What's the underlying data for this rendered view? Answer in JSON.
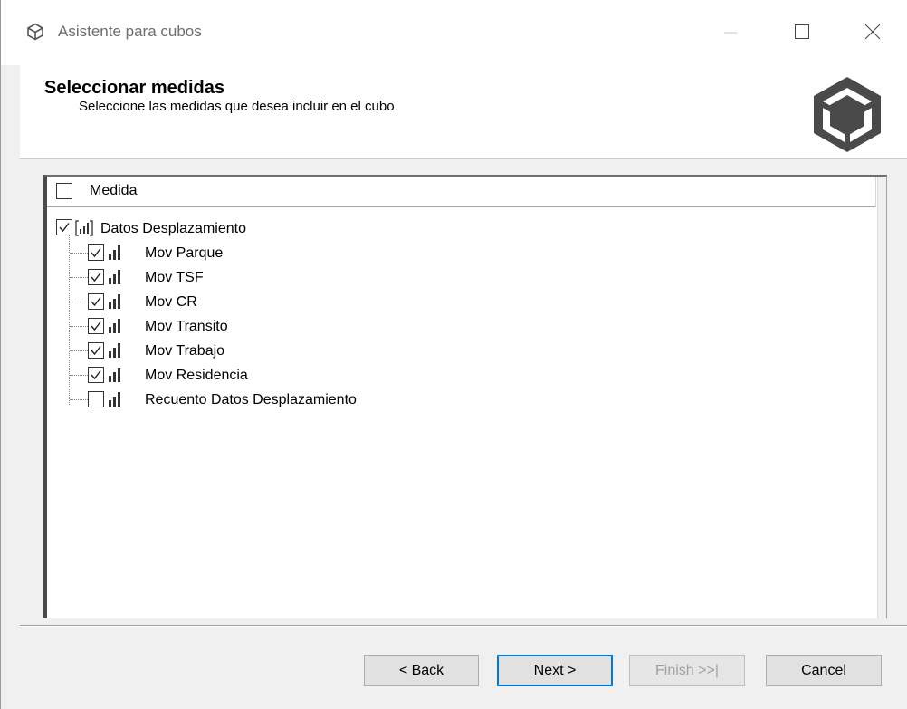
{
  "window": {
    "title": "Asistente para cubos"
  },
  "header": {
    "title": "Seleccionar medidas",
    "subtitle": "Seleccione las medidas que desea incluir en el cubo."
  },
  "list": {
    "column_header": "Medida",
    "header_checked": false,
    "group": {
      "label": "Datos Desplazamiento",
      "checked": true,
      "icon": "measure-group-icon"
    },
    "items": [
      {
        "label": "Mov Parque",
        "checked": true,
        "icon": "measure-icon"
      },
      {
        "label": "Mov TSF",
        "checked": true,
        "icon": "measure-icon"
      },
      {
        "label": "Mov CR",
        "checked": true,
        "icon": "measure-icon"
      },
      {
        "label": "Mov Transito",
        "checked": true,
        "icon": "measure-icon"
      },
      {
        "label": "Mov Trabajo",
        "checked": true,
        "icon": "measure-icon"
      },
      {
        "label": "Mov Residencia",
        "checked": true,
        "icon": "measure-icon"
      },
      {
        "label": "Recuento Datos Desplazamiento",
        "checked": false,
        "icon": "measure-icon"
      }
    ]
  },
  "buttons": {
    "back": "< Back",
    "next": "Next >",
    "finish": "Finish >>|",
    "cancel": "Cancel"
  },
  "colors": {
    "focus_border": "#0078d7",
    "disabled_text": "#a0a0a0",
    "icon_dark": "#4a4a4a"
  }
}
